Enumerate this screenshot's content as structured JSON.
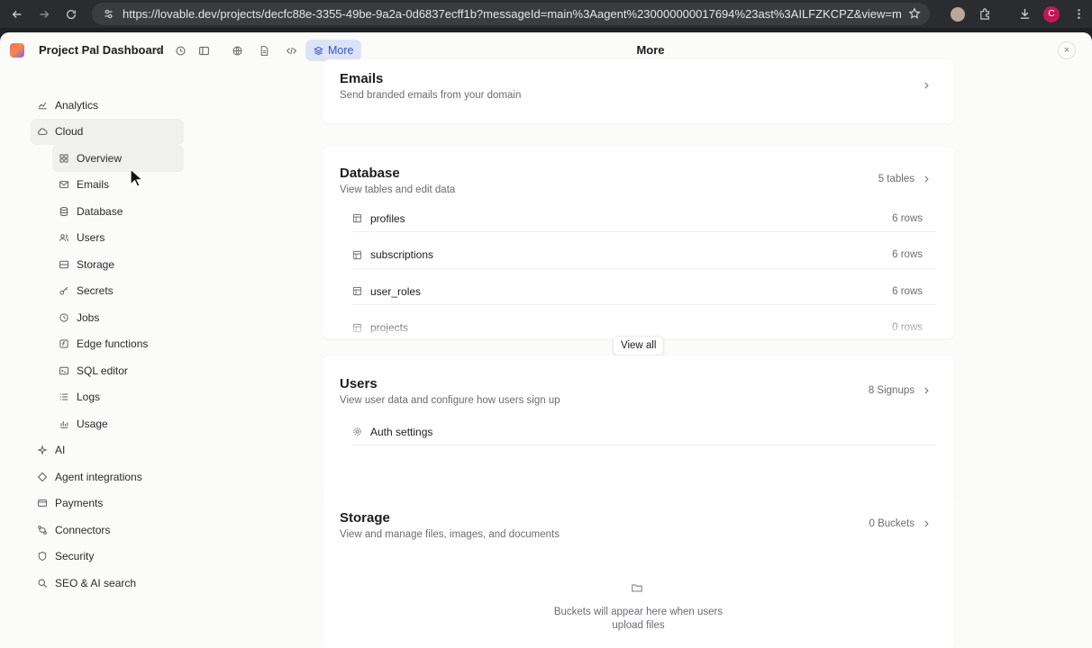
{
  "browser": {
    "url": "https://lovable.dev/projects/decfc88e-3355-49be-9a2a-0d6837ecff1b?messageId=main%3Aagent%230000000017694%23ast%3AILFZKCPZ&view=m...",
    "profile_initial": "C",
    "colors": {
      "profile": "#c2185b"
    }
  },
  "topbar": {
    "project_name": "Project Pal Dashboard",
    "more_label": "More",
    "title": "More",
    "close_symbol": "×"
  },
  "sidebar": {
    "items": [
      {
        "label": "Analytics",
        "icon": "chart-line-icon",
        "level": 0
      },
      {
        "label": "Cloud",
        "icon": "cloud-icon",
        "level": 0,
        "active": true
      },
      {
        "label": "Overview",
        "icon": "grid-icon",
        "level": 1,
        "active": true
      },
      {
        "label": "Emails",
        "icon": "mail-icon",
        "level": 1
      },
      {
        "label": "Database",
        "icon": "database-icon",
        "level": 1
      },
      {
        "label": "Users",
        "icon": "users-icon",
        "level": 1
      },
      {
        "label": "Storage",
        "icon": "storage-icon",
        "level": 1
      },
      {
        "label": "Secrets",
        "icon": "key-icon",
        "level": 1
      },
      {
        "label": "Jobs",
        "icon": "clock-icon",
        "level": 1
      },
      {
        "label": "Edge functions",
        "icon": "function-icon",
        "level": 1
      },
      {
        "label": "SQL editor",
        "icon": "terminal-icon",
        "level": 1
      },
      {
        "label": "Logs",
        "icon": "list-icon",
        "level": 1
      },
      {
        "label": "Usage",
        "icon": "bar-chart-icon",
        "level": 1
      },
      {
        "label": "AI",
        "icon": "ai-icon",
        "level": 0
      },
      {
        "label": "Agent integrations",
        "icon": "diamond-icon",
        "level": 0
      },
      {
        "label": "Payments",
        "icon": "credit-card-icon",
        "level": 0
      },
      {
        "label": "Connectors",
        "icon": "connectors-icon",
        "level": 0
      },
      {
        "label": "Security",
        "icon": "shield-icon",
        "level": 0
      },
      {
        "label": "SEO & AI search",
        "icon": "search-icon",
        "level": 0
      }
    ]
  },
  "main": {
    "emails": {
      "title": "Emails",
      "subtitle": "Send branded emails from your domain"
    },
    "database": {
      "title": "Database",
      "subtitle": "View tables and edit data",
      "meta": "5 tables",
      "tables": [
        {
          "name": "profiles",
          "rows": "6 rows"
        },
        {
          "name": "subscriptions",
          "rows": "6 rows"
        },
        {
          "name": "user_roles",
          "rows": "6 rows"
        },
        {
          "name": "projects",
          "rows": "0 rows"
        }
      ],
      "view_all": "View all"
    },
    "users": {
      "title": "Users",
      "subtitle": "View user data and configure how users sign up",
      "meta": "8 Signups",
      "auth_settings": "Auth settings"
    },
    "storage": {
      "title": "Storage",
      "subtitle": "View and manage files, images, and documents",
      "meta": "0 Buckets",
      "empty_line1": "Buckets will appear here when users",
      "empty_line2": "upload files"
    }
  }
}
